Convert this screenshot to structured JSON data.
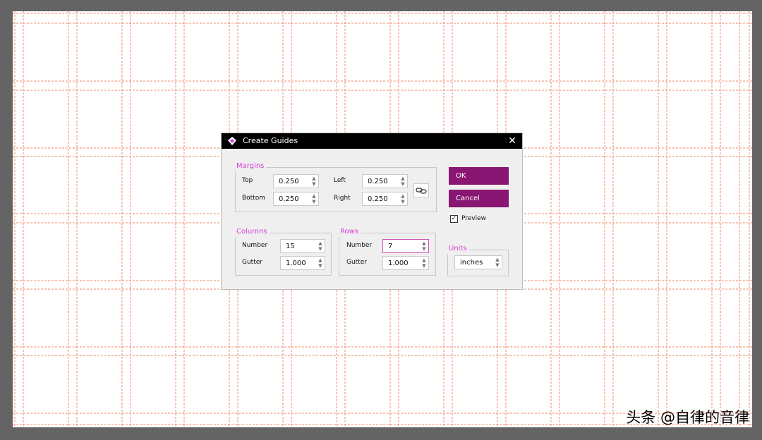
{
  "dialog": {
    "title": "Create Guides",
    "margins": {
      "label": "Margins",
      "top_label": "Top",
      "top": "0.250",
      "bottom_label": "Bottom",
      "bottom": "0.250",
      "left_label": "Left",
      "left": "0.250",
      "right_label": "Right",
      "right": "0.250",
      "link_icon": "chain-link-icon"
    },
    "columns": {
      "label": "Columns",
      "number_label": "Number",
      "number": "15",
      "gutter_label": "Gutter",
      "gutter": "1.000"
    },
    "rows": {
      "label": "Rows",
      "number_label": "Number",
      "number": "7",
      "gutter_label": "Gutter",
      "gutter": "1.000"
    },
    "ok_label": "OK",
    "cancel_label": "Cancel",
    "preview_label": "Preview",
    "preview_checked": true,
    "units": {
      "label": "Units",
      "value": "inches"
    }
  },
  "watermark": "头条 @自律的音律",
  "colors": {
    "accent": "#881672",
    "group_label": "#d63fd6",
    "guide": "#f08a6a",
    "workspace": "#646464"
  }
}
